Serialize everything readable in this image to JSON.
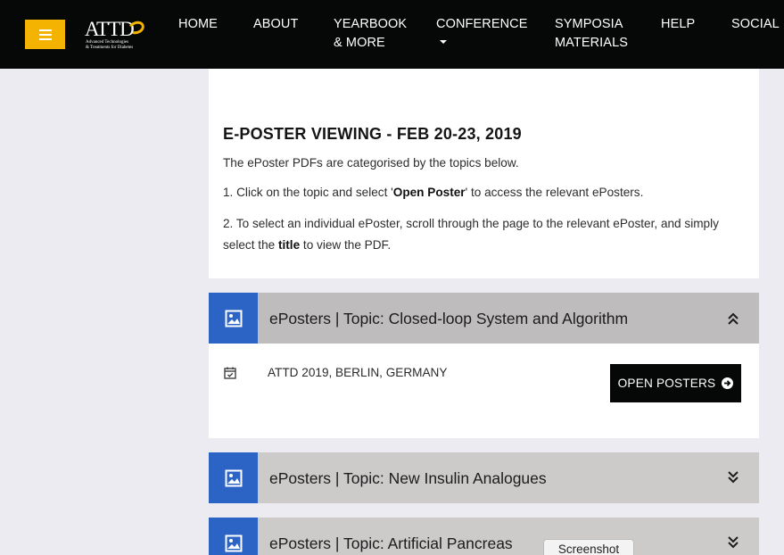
{
  "nav": {
    "logo": {
      "main": "ATTD",
      "sub_line1": "Advanced Technologies",
      "sub_line2": "& Treatments for Diabetes"
    },
    "items": [
      {
        "label": "HOME"
      },
      {
        "label": "ABOUT"
      },
      {
        "label_line1": "YEARBOOK",
        "label_line2": "& MORE"
      },
      {
        "label": "CONFERENCE"
      },
      {
        "label_line1": "SYMPOSIA",
        "label_line2": "MATERIALS"
      },
      {
        "label": "HELP"
      },
      {
        "label": "SOCIAL"
      }
    ]
  },
  "intro": {
    "heading": "E-POSTER VIEWING - FEB 20-23, 2019",
    "p1": "The ePoster PDFs are categorised by the topics below.",
    "p2_pre": "1. Click on the topic and select '",
    "p2_bold": "Open Poster",
    "p2_post": "' to access the relevant ePosters.",
    "p3_pre": "2. To select an individual ePoster, scroll through the page to the relevant ePoster, and simply select the ",
    "p3_bold": "title",
    "p3_post": " to view the PDF."
  },
  "topics": [
    {
      "title": "ePosters | Topic: Closed-loop System and Algorithm",
      "state": "expanded",
      "icon": "image-icon",
      "chevron": "chevron-double-up-icon"
    },
    {
      "title": "ePosters | Topic: New Insulin Analogues",
      "state": "collapsed",
      "icon": "image-icon",
      "chevron": "chevron-double-down-icon"
    },
    {
      "title": "ePosters | Topic: Artificial Pancreas",
      "state": "collapsed",
      "icon": "image-icon",
      "chevron": "chevron-double-down-icon"
    }
  ],
  "topic_body": {
    "location": "ATTD 2019, BERLIN, GERMANY",
    "open_button": "OPEN POSTERS",
    "calendar_icon": "calendar-check-icon",
    "button_icon": "arrow-circle-right-icon"
  },
  "tooltip": "Screenshot",
  "colors": {
    "navbar": "#060707",
    "menu_button": "#f5b301",
    "icon_box": "#2b64c5",
    "topic_header": "#cdcaca",
    "topic_header_open": "#bebcbd",
    "page_bg": "#ecebf1",
    "button": "#060707"
  }
}
